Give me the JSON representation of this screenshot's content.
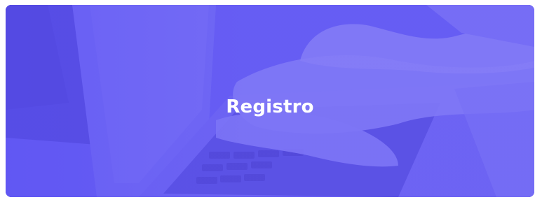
{
  "card": {
    "title": "Registro",
    "accent_color": "#5b53f0",
    "background_image": "laptop-typing-photo"
  }
}
